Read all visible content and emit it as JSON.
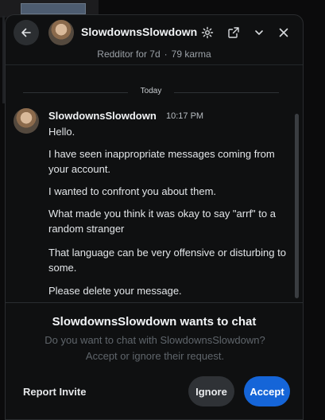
{
  "header": {
    "title": "SlowdownsSlowdown",
    "icons": [
      "back-arrow-icon",
      "gear-icon",
      "pop-out-icon",
      "chevron-down-icon",
      "close-icon"
    ]
  },
  "meta": {
    "age": "Redditor for 7d",
    "separator": "·",
    "karma": "79 karma"
  },
  "day_separator": "Today",
  "message": {
    "author": "SlowdownsSlowdown",
    "time": "10:17 PM",
    "lines": [
      "Hello.",
      "I have seen inappropriate messages coming from your account.",
      "I wanted to confront you about them.",
      "What made you think it was okay to say \"arrf\" to a random stranger",
      "That language can be very offensive or disturbing to some.",
      "Please delete your message."
    ]
  },
  "invite": {
    "title": "SlowdownsSlowdown wants to chat",
    "subtitle": "Do you want to chat with SlowdownsSlowdown? Accept or ignore their request."
  },
  "actions": {
    "report": "Report Invite",
    "ignore": "Ignore",
    "accept": "Accept"
  },
  "colors": {
    "accent": "#1565d8",
    "panel": "#0f1011",
    "muted_text": "#5f656b"
  }
}
